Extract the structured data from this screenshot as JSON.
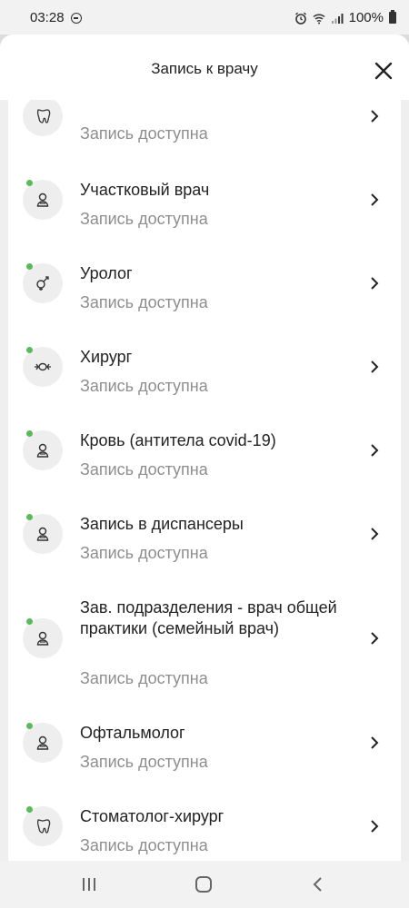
{
  "status_bar": {
    "time": "03:28",
    "battery": "100%",
    "icons": [
      "dnd-icon",
      "alarm-icon",
      "wifi-icon",
      "signal-icon",
      "battery-icon"
    ]
  },
  "header": {
    "title": "Запись к врачу",
    "close_icon": "close-icon"
  },
  "list": {
    "partial_item": {
      "subtitle": "Запись доступна",
      "icon": "tooth-icon"
    },
    "items": [
      {
        "title": "Участковый врач",
        "subtitle": "Запись доступна",
        "icon": "doctor-icon"
      },
      {
        "title": "Уролог",
        "subtitle": "Запись доступна",
        "icon": "gender-icon"
      },
      {
        "title": "Хирург",
        "subtitle": "Запись доступна",
        "icon": "surgery-icon"
      },
      {
        "title": "Кровь (антитела covid-19)",
        "subtitle": "Запись доступна",
        "icon": "doctor-icon"
      },
      {
        "title": "Запись в диспансеры",
        "subtitle": "Запись доступна",
        "icon": "doctor-icon"
      },
      {
        "title": "Зав. подразделения - врач общей практики (семейный врач)",
        "subtitle": "Запись доступна",
        "icon": "doctor-icon"
      },
      {
        "title": "Офтальмолог",
        "subtitle": "Запись доступна",
        "icon": "doctor-icon"
      },
      {
        "title": "Стоматолог-хирург",
        "subtitle": "Запись доступна",
        "icon": "tooth-icon"
      }
    ]
  },
  "navbar": {
    "buttons": [
      "recents-icon",
      "home-icon",
      "back-icon"
    ]
  },
  "colors": {
    "available_dot": "#5cb85c",
    "subtitle": "#8e8e8e",
    "background": "#efefef"
  }
}
